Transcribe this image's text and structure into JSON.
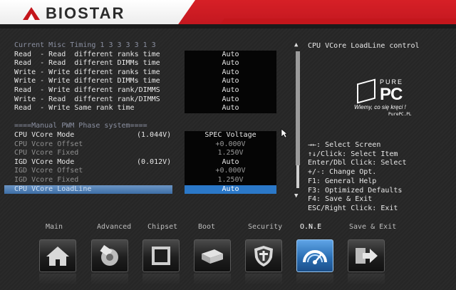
{
  "brand": {
    "name": "BIOSTAR"
  },
  "rows": [
    {
      "label": "Current Misc Timing 1 3 3 3 3 1 3",
      "info": "",
      "value": null,
      "style": "hdr"
    },
    {
      "label": "Read  - Read  different ranks time",
      "info": "",
      "value": "Auto",
      "style": ""
    },
    {
      "label": "Read  - Read  different DIMMs time",
      "info": "",
      "value": "Auto",
      "style": ""
    },
    {
      "label": "Write - Write different ranks time",
      "info": "",
      "value": "Auto",
      "style": ""
    },
    {
      "label": "Write - Write different DIMMs time",
      "info": "",
      "value": "Auto",
      "style": ""
    },
    {
      "label": "Read  - Write different rank/DIMMS",
      "info": "",
      "value": "Auto",
      "style": ""
    },
    {
      "label": "Write - Read  different rank/DIMMS",
      "info": "",
      "value": "Auto",
      "style": ""
    },
    {
      "label": "Read  - Write Same rank time",
      "info": "",
      "value": "Auto",
      "style": ""
    },
    {
      "label": "",
      "info": "",
      "value": null,
      "style": ""
    },
    {
      "label": "====Manual PWM Phase system====",
      "info": "",
      "value": null,
      "style": "hdr"
    },
    {
      "label": "CPU VCore Mode",
      "info": "(1.044V)",
      "value": "SPEC Voltage",
      "style": ""
    },
    {
      "label": "CPU Vcore Offset",
      "info": "",
      "value": "+0.000V",
      "style": "dim"
    },
    {
      "label": "CPU Vcore Fixed",
      "info": "",
      "value": "1.250V",
      "style": "dim"
    },
    {
      "label": "IGD VCore Mode",
      "info": "(0.012V)",
      "value": "Auto",
      "style": ""
    },
    {
      "label": "IGD Vcore Offset",
      "info": "",
      "value": "+0.000V",
      "style": "dim"
    },
    {
      "label": "IGD Vcore Fixed",
      "info": "",
      "value": "1.250V",
      "style": "dim"
    },
    {
      "label": "CPU VCore LoadLine",
      "info": "",
      "value": "Auto",
      "style": "selected"
    }
  ],
  "scrollbar": {
    "up": "▲",
    "down": "▼"
  },
  "help": {
    "title": "CPU VCore LoadLine control",
    "keys": [
      "→←: Select Screen",
      "↑↓/Click: Select Item",
      "Enter/Dbl Click: Select",
      "+/-: Change Opt.",
      "F1: General Help",
      "F3: Optimized Defaults",
      "F4: Save & Exit",
      "ESC/Right Click: Exit"
    ]
  },
  "watermark": {
    "pure": "PURE",
    "pc": "PC",
    "tagline": "Wiemy, co się kręci !",
    "url": "PurePC.PL"
  },
  "nav": [
    {
      "label": "Main",
      "icon": "home-icon",
      "active": false
    },
    {
      "label": "Advanced",
      "icon": "advanced-icon",
      "active": false
    },
    {
      "label": "Chipset",
      "icon": "chipset-icon",
      "active": false
    },
    {
      "label": "Boot",
      "icon": "boot-icon",
      "active": false
    },
    {
      "label": "Security",
      "icon": "security-shield-icon",
      "active": false
    },
    {
      "label": "O.N.E",
      "icon": "speedometer-icon",
      "active": true
    },
    {
      "label": "Save & Exit",
      "icon": "exit-arrow-icon",
      "active": false
    }
  ],
  "colors": {
    "accent": "#2b78c8",
    "brand_red": "#c4161c",
    "selected_label": "#5b88bd"
  }
}
